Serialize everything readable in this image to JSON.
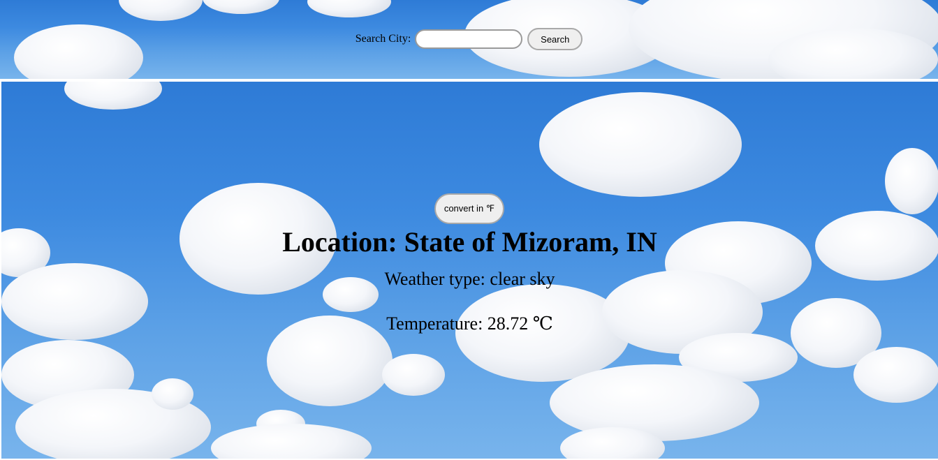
{
  "search": {
    "label": "Search City:",
    "input_value": "",
    "input_placeholder": "",
    "button_label": "Search"
  },
  "weather": {
    "convert_label": "convert in ℉",
    "location": "Location: State of Mizoram, IN",
    "weather_type": "Weather type: clear sky",
    "temperature": "Temperature: 28.72 ℃"
  },
  "colors": {
    "sky": "#3d8ae0",
    "divider": "#ffffff",
    "button_bg": "#efefef"
  }
}
